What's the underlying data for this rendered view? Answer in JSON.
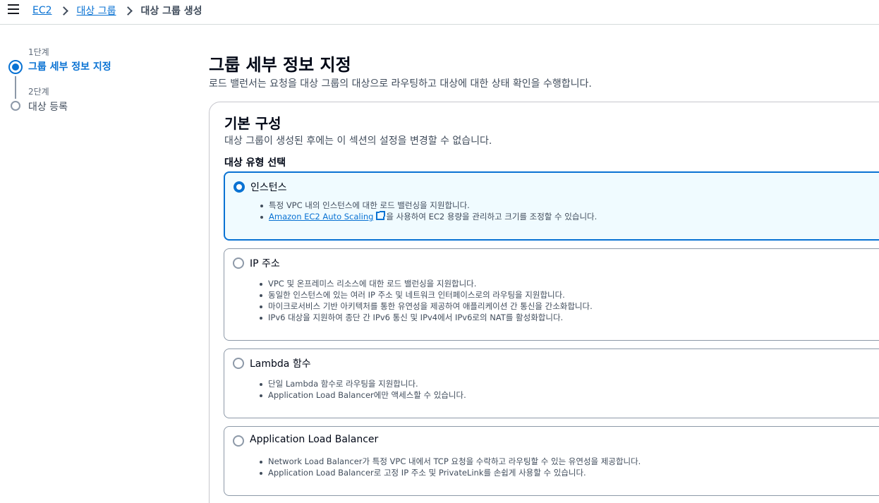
{
  "breadcrumbs": {
    "items": [
      {
        "label": "EC2"
      },
      {
        "label": "대상 그룹"
      },
      {
        "label": "대상 그룹 생성"
      }
    ]
  },
  "steps": [
    {
      "number_label": "1단계",
      "title": "그룹 세부 정보 지정",
      "state": "active"
    },
    {
      "number_label": "2단계",
      "title": "대상 등록",
      "state": "inactive"
    }
  ],
  "page": {
    "title": "그룹 세부 정보 지정",
    "description": "로드 밸런서는 요청을 대상 그룹의 대상으로 라우팅하고 대상에 대한 상태 확인을 수행합니다."
  },
  "basic_config": {
    "title": "기본 구성",
    "description": "대상 그룹이 생성된 후에는 이 섹션의 설정을 변경할 수 없습니다.",
    "target_type_label": "대상 유형 선택",
    "options": [
      {
        "title": "인스턴스",
        "selected": true,
        "bullets": [
          "특정 VPC 내의 인스턴스에 대한 로드 밸런싱을 지원합니다."
        ],
        "link_bullet": {
          "link": "Amazon EC2 Auto Scaling",
          "icon": "external-link-icon",
          "rest": "을 사용하여 EC2 용량을 관리하고 크기를 조정할 수 있습니다."
        }
      },
      {
        "title": "IP 주소",
        "selected": false,
        "bullets": [
          "VPC 및 온프레미스 리소스에 대한 로드 밸런싱을 지원합니다.",
          "동일한 인스턴스에 있는 여러 IP 주소 및 네트워크 인터페이스로의 라우팅을 지원합니다.",
          "마이크로서비스 기반 아키텍처를 통한 유연성을 제공하여 애플리케이션 간 통신을 간소화합니다.",
          "IPv6 대상을 지원하여 종단 간 IPv6 통신 및 IPv4에서 IPv6로의 NAT를 활성화합니다."
        ]
      },
      {
        "title": "Lambda 함수",
        "selected": false,
        "bullets": [
          "단일 Lambda 함수로 라우팅을 지원합니다.",
          "Application Load Balancer에만 액세스할 수 있습니다."
        ]
      },
      {
        "title": "Application Load Balancer",
        "selected": false,
        "bullets": [
          "Network Load Balancer가 특정 VPC 내에서 TCP 요청을 수락하고 라우팅할 수 있는 유연성을 제공합니다.",
          "Application Load Balancer로 고정 IP 주소 및 PrivateLink를 손쉽게 사용할 수 있습니다."
        ]
      }
    ]
  },
  "colors": {
    "accent": "#0972d3",
    "selected_bg": "#f0fbff",
    "border": "#8d99a8"
  }
}
